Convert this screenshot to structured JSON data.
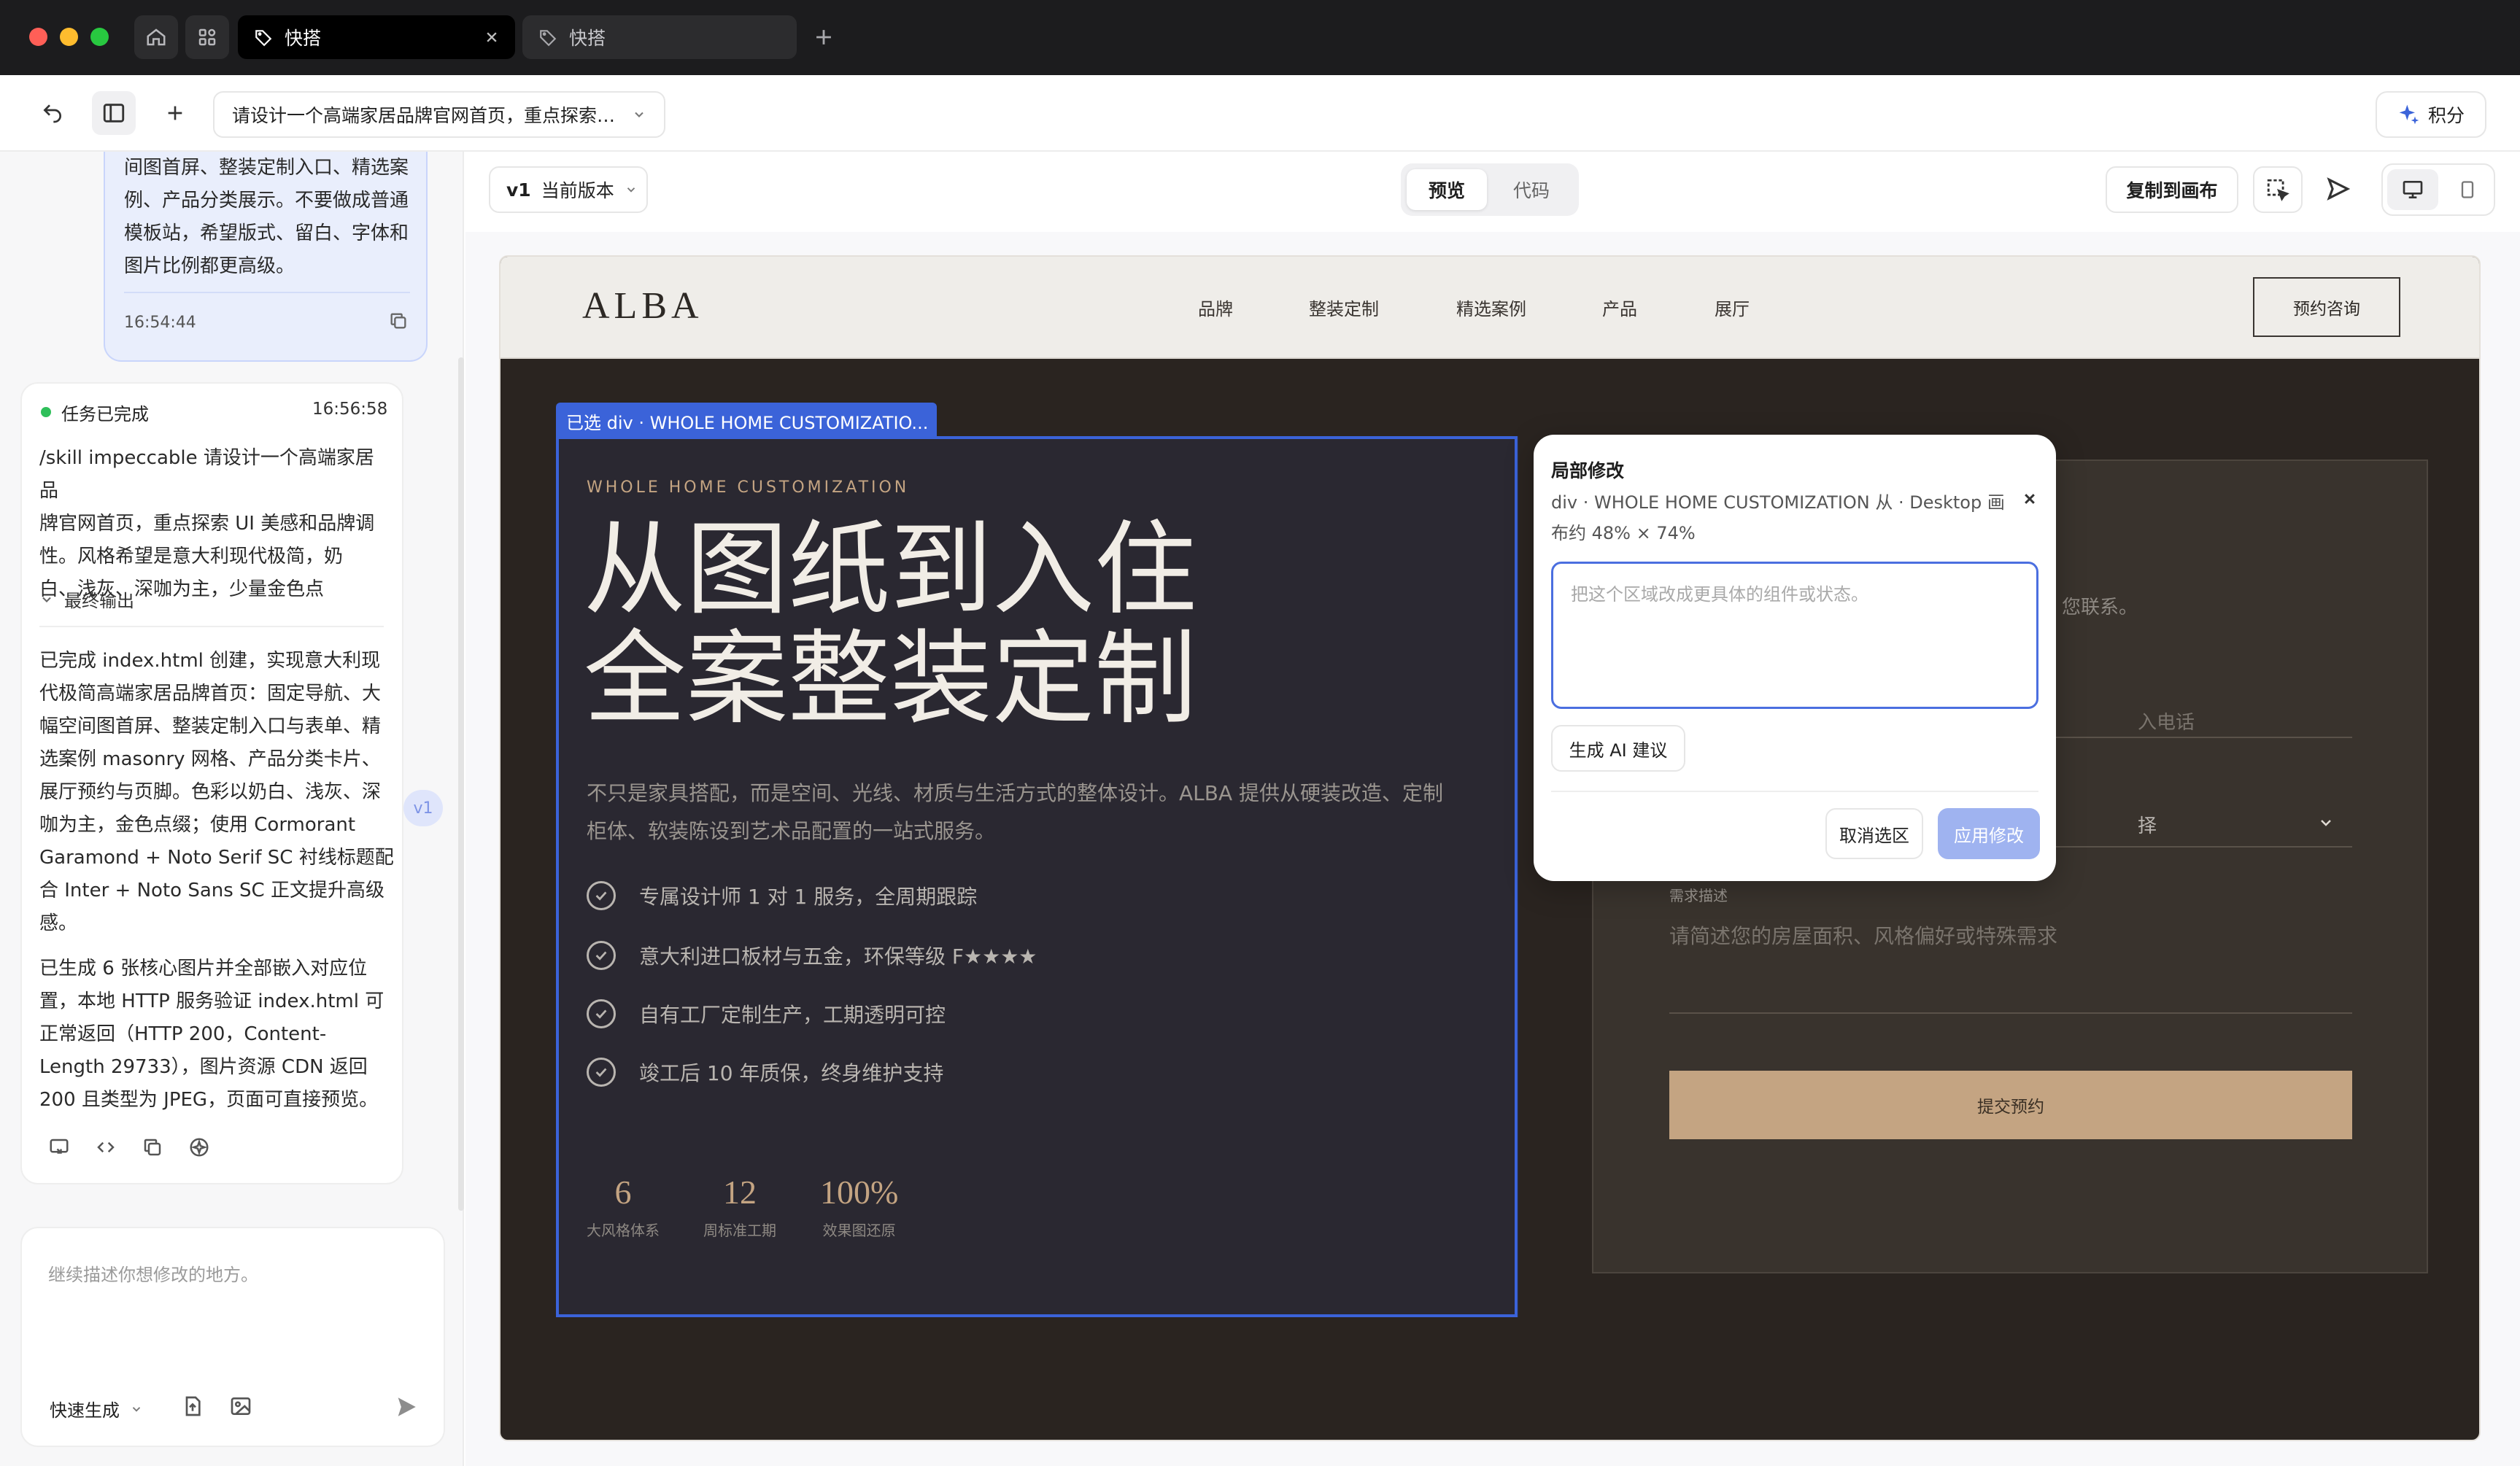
{
  "window": {
    "tabs": [
      {
        "label": "快搭",
        "active": true
      },
      {
        "label": "快搭",
        "active": false
      }
    ]
  },
  "toolbar": {
    "project_title": "请设计一个高端家居品牌官网首页，重点探索 U...",
    "points_label": "积分"
  },
  "chat": {
    "user_message_lines": [
      "间图首屏、整装定制入口、精选案",
      "例、产品分类展示。不要做成普通",
      "模板站，希望版式、留白、字体和",
      "图片比例都更高级。"
    ],
    "user_time": "16:54:44",
    "task_status": "任务已完成",
    "task_time": "16:56:58",
    "task_prompt_lines": [
      "/skill impeccable 请设计一个高端家居品",
      "牌官网首页，重点探索 UI 美感和品牌调",
      "性。风格希望是意大利现代极简，奶",
      "白、浅灰、深咖为主，少量金色点"
    ],
    "final_output_label": "最终输出",
    "result1_lines": [
      "已完成 index.html 创建，实现意大利现",
      "代极简高端家居品牌首页：固定导航、大",
      "幅空间图首屏、整装定制入口与表单、精",
      "选案例 masonry 网格、产品分类卡片、",
      "展厅预约与页脚。色彩以奶白、浅灰、深",
      "咖为主，金色点缀；使用 Cormorant",
      "Garamond + Noto Serif SC 衬线标题配",
      "合 Inter + Noto Sans SC 正文提升高级",
      "感。"
    ],
    "result2_lines": [
      "已生成 6 张核心图片并全部嵌入对应位",
      "置，本地 HTTP 服务验证 index.html 可",
      "正常返回（HTTP 200，Content-",
      "Length 29733），图片资源 CDN 返回",
      "200 且类型为 JPEG，页面可直接预览。"
    ],
    "version_chip": "v1",
    "input_placeholder": "继续描述你想修改的地方。",
    "mode_label": "快速生成"
  },
  "preview_toolbar": {
    "version_label": "v1",
    "version_text": "当前版本",
    "tab_preview": "预览",
    "tab_code": "代码",
    "copy_button": "复制到画布"
  },
  "site": {
    "logo": "ALBA",
    "nav": [
      "品牌",
      "整装定制",
      "精选案例",
      "产品",
      "展厅"
    ],
    "cta": "预约咨询",
    "eyebrow": "WHOLE HOME CUSTOMIZATION",
    "headline_line1": "从图纸到入住",
    "headline_line2": "全案整装定制",
    "desc_line1": "不只是家具搭配，而是空间、光线、材质与生活方式的整体设计。ALBA 提供从硬装改造、定制",
    "desc_line2": "柜体、软装陈设到艺术品配置的一站式服务。",
    "features": [
      "专属设计师 1 对 1 服务，全周期跟踪",
      "意大利进口板材与五金，环保等级 F★★★★",
      "自有工厂定制生产，工期透明可控",
      "竣工后 10 年质保，终身维护支持"
    ],
    "stats": [
      {
        "value": "6",
        "label": "大风格体系"
      },
      {
        "value": "12",
        "label": "周标准工期"
      },
      {
        "value": "100%",
        "label": "效果图还原"
      }
    ],
    "form_partial_contact": "您联系。",
    "form_phone_partial": "入电话",
    "form_select_partial": "择",
    "form_desc_label": "需求描述",
    "form_desc_placeholder": "请简述您的房屋面积、风格偏好或特殊需求",
    "form_submit": "提交预约"
  },
  "selection": {
    "tag": "已选 div · WHOLE HOME CUSTOMIZATIO..."
  },
  "popup": {
    "title": "局部修改",
    "subtitle_line1": "div · WHOLE HOME CUSTOMIZATION 从 · Desktop 画",
    "subtitle_line2": "布约 48% × 74%",
    "textarea_placeholder": "把这个区域改成更具体的组件或状态。",
    "ai_button": "生成 AI 建议",
    "cancel_button": "取消选区",
    "apply_button": "应用修改"
  },
  "colors": {
    "accent_blue": "#3b63d9",
    "gold": "#c4a482",
    "hero_bg": "#2a2831",
    "site_bg": "#2a2420"
  }
}
